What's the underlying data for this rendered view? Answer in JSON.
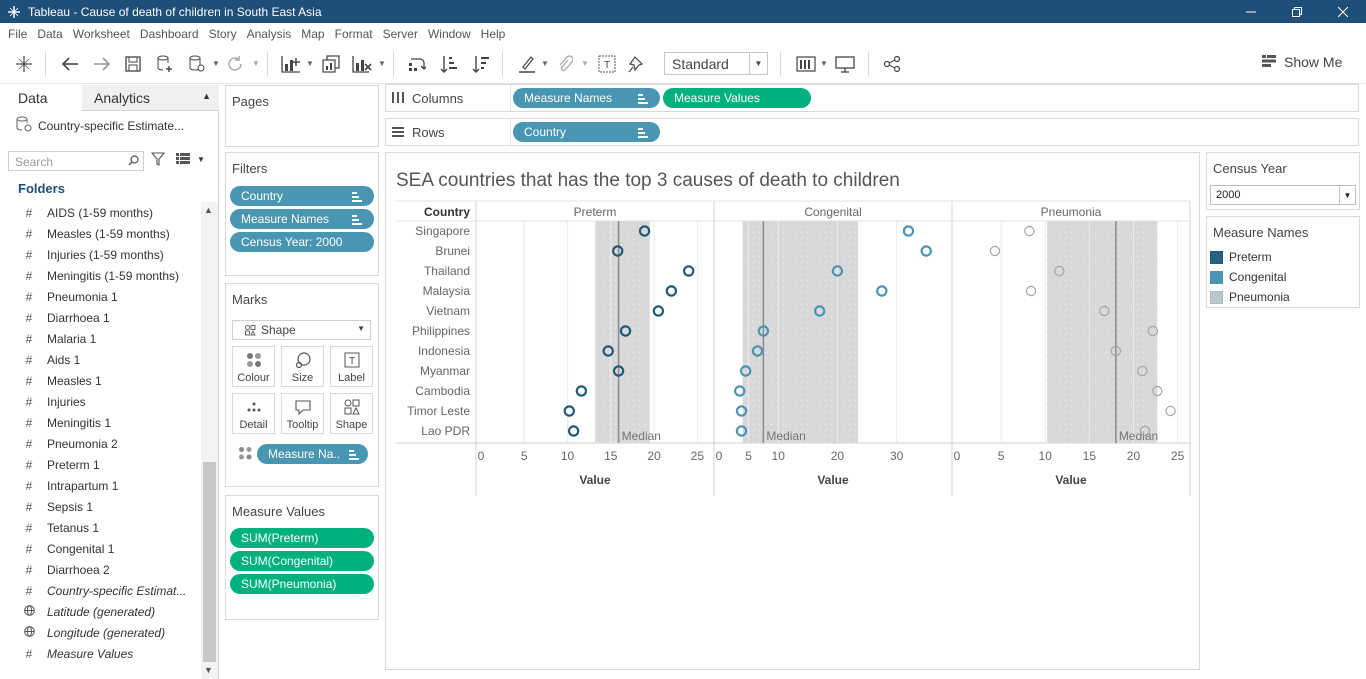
{
  "window": {
    "title": "Tableau - Cause of death of children in South East Asia"
  },
  "menu": [
    "File",
    "Data",
    "Worksheet",
    "Dashboard",
    "Story",
    "Analysis",
    "Map",
    "Format",
    "Server",
    "Window",
    "Help"
  ],
  "toolbar": {
    "fit_select": "Standard",
    "show_me_label": "Show Me"
  },
  "data_pane": {
    "tab_data": "Data",
    "tab_analytics": "Analytics",
    "datasource": "Country-specific Estimate...",
    "search_placeholder": "Search",
    "folders_heading": "Folders",
    "fields": [
      {
        "label": "AIDS (1-59 months)",
        "icon": "measure-hash-icon",
        "italic": false
      },
      {
        "label": "Measles (1-59 months)",
        "icon": "measure-hash-icon",
        "italic": false
      },
      {
        "label": "Injuries  (1-59 months)",
        "icon": "measure-hash-icon",
        "italic": false
      },
      {
        "label": "Meningitis  (1-59 months)",
        "icon": "measure-hash-icon",
        "italic": false
      },
      {
        "label": "Pneumonia 1",
        "icon": "measure-hash-icon",
        "italic": false
      },
      {
        "label": "Diarrhoea 1",
        "icon": "measure-hash-icon",
        "italic": false
      },
      {
        "label": "Malaria 1",
        "icon": "measure-hash-icon",
        "italic": false
      },
      {
        "label": "Aids 1",
        "icon": "measure-hash-icon",
        "italic": false
      },
      {
        "label": "Measles 1",
        "icon": "measure-hash-icon",
        "italic": false
      },
      {
        "label": "Injuries",
        "icon": "measure-hash-icon",
        "italic": false
      },
      {
        "label": "Meningitis 1",
        "icon": "measure-hash-icon",
        "italic": false
      },
      {
        "label": "Pneumonia 2",
        "icon": "measure-hash-icon",
        "italic": false
      },
      {
        "label": "Preterm 1",
        "icon": "measure-hash-icon",
        "italic": false
      },
      {
        "label": "Intrapartum 1",
        "icon": "measure-hash-icon",
        "italic": false
      },
      {
        "label": "Sepsis 1",
        "icon": "measure-hash-icon",
        "italic": false
      },
      {
        "label": "Tetanus 1",
        "icon": "measure-hash-icon",
        "italic": false
      },
      {
        "label": "Congenital 1",
        "icon": "measure-hash-icon",
        "italic": false
      },
      {
        "label": "Diarrhoea 2",
        "icon": "measure-hash-icon",
        "italic": false
      },
      {
        "label": "Country-specific Estimat...",
        "icon": "measure-hash-icon",
        "italic": true
      },
      {
        "label": "Latitude (generated)",
        "icon": "globe-icon",
        "italic": true
      },
      {
        "label": "Longitude (generated)",
        "icon": "globe-icon",
        "italic": true
      },
      {
        "label": "Measure Values",
        "icon": "measure-hash-icon",
        "italic": true
      }
    ]
  },
  "pages": {
    "title": "Pages"
  },
  "filters": {
    "title": "Filters",
    "pills": [
      "Country",
      "Measure Names",
      "Census Year: 2000"
    ]
  },
  "marks": {
    "title": "Marks",
    "type": "Shape",
    "buttons": [
      "Colour",
      "Size",
      "Label",
      "Detail",
      "Tooltip",
      "Shape"
    ],
    "field_pill": "Measure Na.."
  },
  "measure_values": {
    "title": "Measure Values",
    "pills": [
      "SUM(Preterm)",
      "SUM(Congenital)",
      "SUM(Pneumonia)"
    ]
  },
  "columns_shelf": {
    "label": "Columns",
    "pills": [
      {
        "label": "Measure Names",
        "color": "blue"
      },
      {
        "label": "Measure Values",
        "color": "green"
      }
    ]
  },
  "rows_shelf": {
    "label": "Rows",
    "pills": [
      {
        "label": "Country",
        "color": "blue"
      }
    ]
  },
  "census_year": {
    "title": "Census Year",
    "value": "2000"
  },
  "measure_legend": {
    "title": "Measure Names",
    "items": [
      {
        "label": "Preterm",
        "color": "#1f5a7a"
      },
      {
        "label": "Congenital",
        "color": "#4a94b5"
      },
      {
        "label": "Pneumonia",
        "color": "#a9b9c4"
      }
    ]
  },
  "chart_data": {
    "type": "scatter",
    "title": "SEA countries that has the top 3 causes of death to children",
    "row_header": "Country",
    "reference_label": "Median",
    "categories": [
      "Singapore",
      "Brunei",
      "Thailand",
      "Malaysia",
      "Vietnam",
      "Philippines",
      "Indonesia",
      "Myanmar",
      "Cambodia",
      "Timor Leste",
      "Lao PDR"
    ],
    "panes": [
      {
        "name": "Preterm",
        "color": "#1f5a7a",
        "xlabel": "Value",
        "xlim": [
          0,
          26
        ],
        "ticks": [
          0,
          5,
          10,
          15,
          20,
          25
        ],
        "median": 15.9,
        "band": [
          13.2,
          19.5
        ],
        "values": [
          18.9,
          15.8,
          24.0,
          22.0,
          20.5,
          16.7,
          14.7,
          15.9,
          11.6,
          10.2,
          10.7
        ]
      },
      {
        "name": "Congenital",
        "color": "#4a94b5",
        "xlabel": "Value",
        "xlim": [
          0,
          38
        ],
        "ticks": [
          0,
          5,
          10,
          20,
          30
        ],
        "median": 7.5,
        "band": [
          4.0,
          23.5
        ],
        "values": [
          32.0,
          35.0,
          20.0,
          27.5,
          17.0,
          7.5,
          6.5,
          4.5,
          3.5,
          3.8,
          3.8
        ]
      },
      {
        "name": "Pneumonia",
        "color": "#a4a4a4",
        "xlabel": "Value",
        "xlim": [
          0,
          25.5
        ],
        "ticks": [
          0,
          5,
          10,
          15,
          20,
          25
        ],
        "median": 18.0,
        "band": [
          10.2,
          22.7
        ],
        "values": [
          8.2,
          4.3,
          11.6,
          8.4,
          16.7,
          22.2,
          18.0,
          21.0,
          22.7,
          24.2,
          21.3
        ]
      }
    ]
  }
}
